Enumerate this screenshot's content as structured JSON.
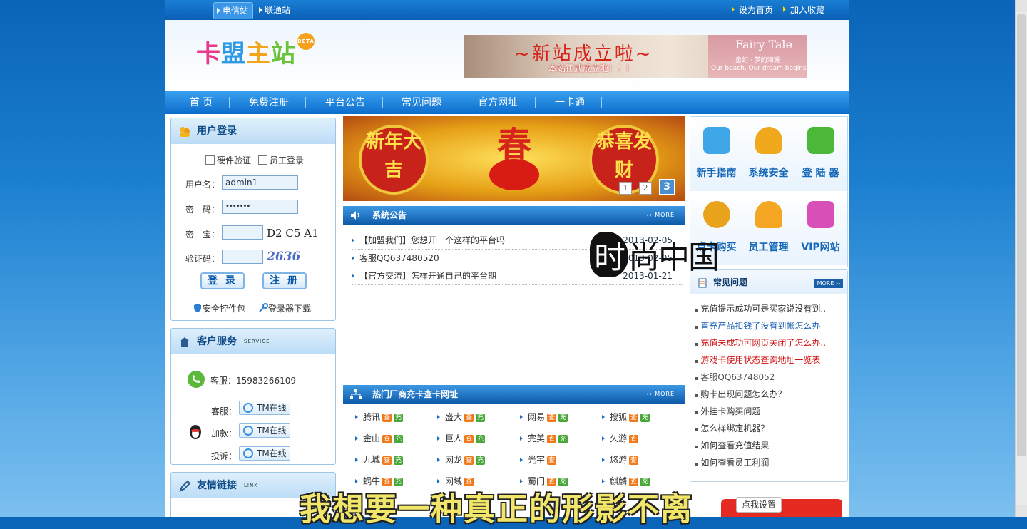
{
  "topbar": {
    "stations": [
      "电信站",
      "联通站"
    ],
    "links": [
      "设为首页",
      "加入收藏"
    ]
  },
  "header": {
    "logo_text": [
      "卡",
      "盟",
      "主",
      "站"
    ],
    "logo_badge": "BETA",
    "banner_title": "~新站成立啦~",
    "banner_sub": "本站正式成立啦！！！",
    "banner_fairy": "Fairy Tale",
    "banner_fairy_sub": "童幻 · 梦的海滩",
    "banner_fairy_en": "Our beach, Our dream begins"
  },
  "nav": [
    "首 页",
    "免费注册",
    "平台公告",
    "常见问题",
    "官方网址",
    "一卡通"
  ],
  "login": {
    "title": "用户登录",
    "hardware": "硬件验证",
    "staff": "员工登录",
    "username_label": "用户名：",
    "username_value": "admin1",
    "password_label": "密　码：",
    "password_value": "•••••••",
    "mibao_label": "密　宝：",
    "mibao_code": "D2 C5 A1",
    "captcha_label": "验证码：",
    "captcha_code": "2636",
    "login_btn": "登 录",
    "register_btn": "注 册",
    "security_pack": "安全控件包",
    "login_download": "登录器下载"
  },
  "service": {
    "title": "客户服务",
    "subtitle": "SERVICE",
    "phone": "客服：15983266109",
    "rows": [
      {
        "label": "客服：",
        "btn": "TM在线"
      },
      {
        "label": "加款：",
        "btn": "TM在线"
      },
      {
        "label": "投诉：",
        "btn": "TM在线"
      }
    ]
  },
  "links": {
    "title": "友情链接",
    "subtitle": "LINK"
  },
  "slider": {
    "left": "新年大吉",
    "right": "恭喜发财",
    "center": "春",
    "dots": [
      "1",
      "2",
      "3"
    ]
  },
  "announcements": {
    "title": "系统公告",
    "more": "MORE",
    "items": [
      {
        "text": "【加盟我们】您想开一个这样的平台吗",
        "date": "2013-02-05"
      },
      {
        "text": "客服QQ637480520",
        "date": "2013-02-05"
      },
      {
        "text": "【官方交流】怎样开通自己的平台期",
        "date": "2013-01-21"
      }
    ]
  },
  "vendors": {
    "title": "热门厂商充卡查卡网址",
    "more": "MORE",
    "tag_cha": "查",
    "tag_chong": "充",
    "rows": [
      [
        {
          "n": "腾讯",
          "t": 2
        },
        {
          "n": "盛大",
          "t": 2
        },
        {
          "n": "网易",
          "t": 2
        },
        {
          "n": "搜狐",
          "t": 2
        }
      ],
      [
        {
          "n": "金山",
          "t": 2
        },
        {
          "n": "巨人",
          "t": 2
        },
        {
          "n": "完美",
          "t": 2
        },
        {
          "n": "久游",
          "t": 1
        }
      ],
      [
        {
          "n": "九城",
          "t": 2
        },
        {
          "n": "网龙",
          "t": 2
        },
        {
          "n": "光宇",
          "t": 1
        },
        {
          "n": "悠游",
          "t": 1
        }
      ],
      [
        {
          "n": "蜗牛",
          "t": 2
        },
        {
          "n": "网域",
          "t": 1
        },
        {
          "n": "蜀门",
          "t": 2
        },
        {
          "n": "麒麟",
          "t": 2
        }
      ]
    ]
  },
  "quick": [
    {
      "label": "新手指南",
      "color": "#3fa7e8"
    },
    {
      "label": "系统安全",
      "color": "#f0a81c"
    },
    {
      "label": "登 陆 器",
      "color": "#4cb83a"
    },
    {
      "label": "点卡购买",
      "color": "#e9a21c"
    },
    {
      "label": "员工管理",
      "color": "#f5a623"
    },
    {
      "label": "VIP网站",
      "color": "#d94fb8"
    }
  ],
  "faq": {
    "title": "常见问题",
    "more": "MORE",
    "items": [
      {
        "text": "充值提示成功可是买家说没有到..",
        "color": "#333333"
      },
      {
        "text": "直充产品扣钱了没有到帐怎么办",
        "color": "#1a5fb4"
      },
      {
        "text": "充值未成功可网页关闭了怎么办..",
        "color": "#d01010"
      },
      {
        "text": "游戏卡使用状态查询地址一览表",
        "color": "#d01010"
      },
      {
        "text": "客服QQ63748052",
        "color": "#555555"
      },
      {
        "text": "购卡出现问题怎么办？",
        "color": "#333333"
      },
      {
        "text": "外挂卡购买问题",
        "color": "#333333"
      },
      {
        "text": "怎么样绑定机器？",
        "color": "#333333"
      },
      {
        "text": "如何查看充值结果",
        "color": "#333333"
      },
      {
        "text": "如何查看员工利润",
        "color": "#333333"
      }
    ]
  },
  "overlay": {
    "watermark": "尚中国",
    "watermark_ink": "时",
    "subtitle": "我想要一种真正的形影不离",
    "dianka_btn": "点我设置"
  }
}
